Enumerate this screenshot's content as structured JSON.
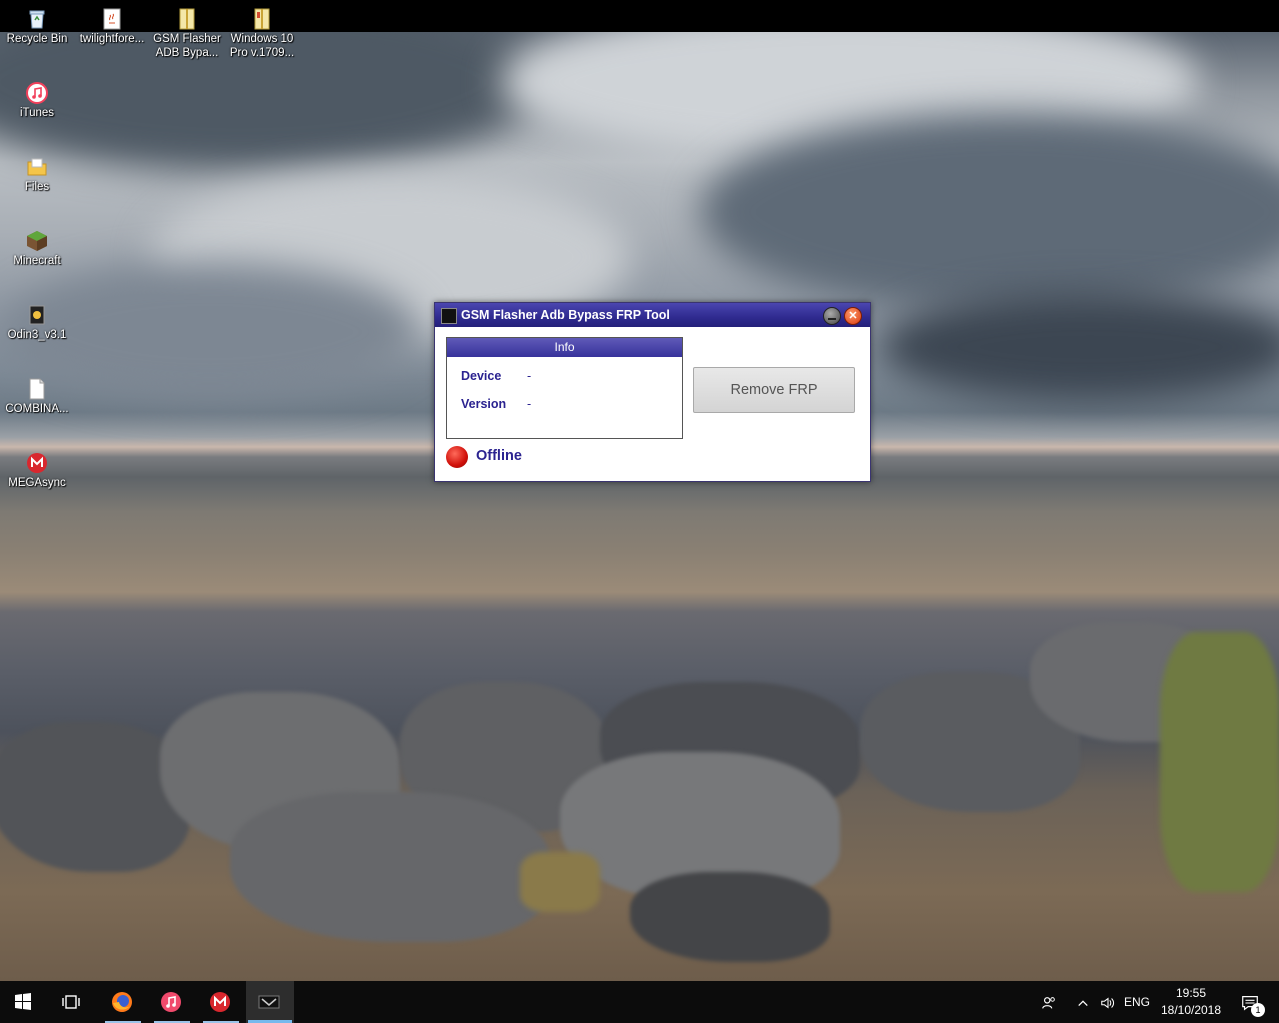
{
  "desktop": {
    "icons": [
      {
        "label": "Recycle Bin",
        "icon": "recycle-bin-icon"
      },
      {
        "label": "twilightfore...",
        "icon": "java-file-icon"
      },
      {
        "label": "GSM Flasher ADB Bypa...",
        "icon": "archive-file-icon"
      },
      {
        "label": "Windows 10 Pro v.1709...",
        "icon": "archive-file-icon"
      },
      {
        "label": "iTunes",
        "icon": "itunes-icon"
      },
      {
        "label": "Files",
        "icon": "folder-icon"
      },
      {
        "label": "Minecraft",
        "icon": "minecraft-icon"
      },
      {
        "label": "Odin3_v3.1",
        "icon": "odin-icon"
      },
      {
        "label": "COMBINA...",
        "icon": "blank-file-icon"
      },
      {
        "label": "MEGAsync",
        "icon": "megasync-icon"
      }
    ],
    "icon_lines": {
      "gsm": [
        "GSM Flasher",
        "ADB Bypa..."
      ],
      "win": [
        "Windows 10",
        "Pro v.1709..."
      ]
    }
  },
  "app": {
    "title": "GSM Flasher Adb Bypass FRP Tool",
    "info_header": "Info",
    "device_label": "Device",
    "device_value": "-",
    "version_label": "Version",
    "version_value": "-",
    "remove_button": "Remove FRP",
    "status": "Offline",
    "status_color": "#e0180c",
    "accent": "#2f2a8f"
  },
  "taskbar": {
    "apps": [
      {
        "name": "start-button",
        "icon": "windows-logo-icon"
      },
      {
        "name": "task-view-button",
        "icon": "task-view-icon"
      },
      {
        "name": "firefox",
        "icon": "firefox-icon"
      },
      {
        "name": "itunes",
        "icon": "itunes-icon"
      },
      {
        "name": "megasync",
        "icon": "megasync-icon"
      },
      {
        "name": "gsm-flasher",
        "icon": "gsm-flasher-icon"
      }
    ],
    "tray": {
      "language": "ENG",
      "time": "19:55",
      "date": "18/10/2018",
      "notification_count": "1"
    }
  }
}
